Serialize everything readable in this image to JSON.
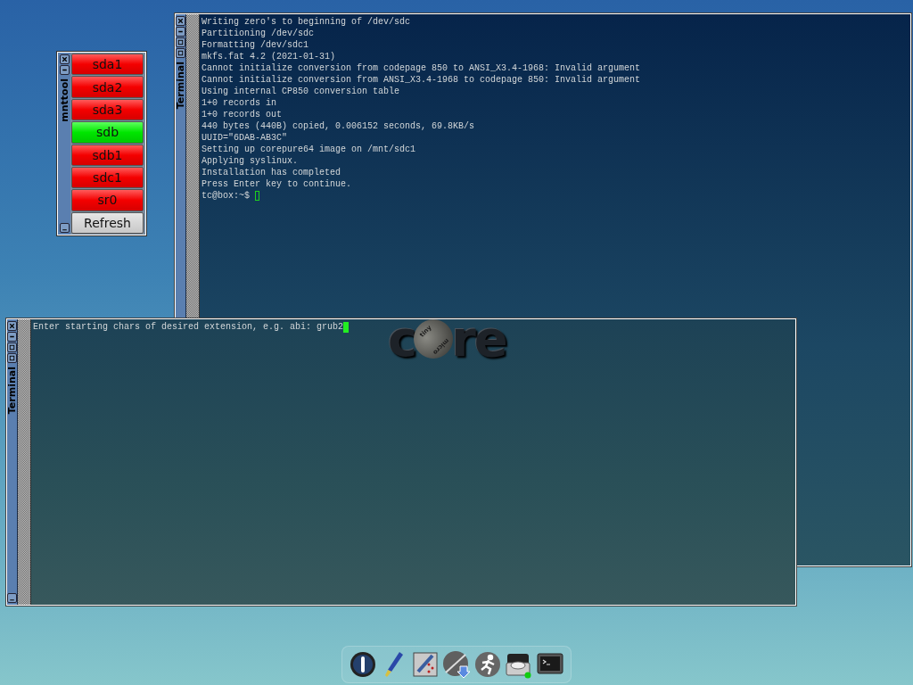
{
  "mnttool": {
    "title": "mnttool",
    "devices": [
      {
        "label": "sda1",
        "kind": "device",
        "mounted": false
      },
      {
        "label": "sda2",
        "kind": "device",
        "mounted": false
      },
      {
        "label": "sda3",
        "kind": "device",
        "mounted": false
      },
      {
        "label": "sdb",
        "kind": "device",
        "mounted": true
      },
      {
        "label": "sdb1",
        "kind": "device",
        "mounted": false
      },
      {
        "label": "sdc1",
        "kind": "device",
        "mounted": false
      },
      {
        "label": "sr0",
        "kind": "device",
        "mounted": false
      },
      {
        "label": "Refresh",
        "kind": "action"
      }
    ]
  },
  "terminals": [
    {
      "title": "Terminal",
      "cursor_filled": false,
      "lines": [
        "Writing zero's to beginning of /dev/sdc",
        "Partitioning /dev/sdc",
        "Formatting /dev/sdc1",
        "mkfs.fat 4.2 (2021-01-31)",
        "Cannot initialize conversion from codepage 850 to ANSI_X3.4-1968: Invalid argument",
        "Cannot initialize conversion from ANSI_X3.4-1968 to codepage 850: Invalid argument",
        "Using internal CP850 conversion table",
        "1+0 records in",
        "1+0 records out",
        "440 bytes (440B) copied, 0.006152 seconds, 69.8KB/s",
        "UUID=\"6DAB-AB3C\"",
        "Setting up corepure64 image on /mnt/sdc1",
        "Applying syslinux.",
        "Installation has completed",
        "Press Enter key to continue.",
        "tc@box:~$ "
      ]
    },
    {
      "title": "Terminal",
      "cursor_filled": true,
      "lines": [
        "Enter starting chars of desired extension, e.g. abi: grub2"
      ]
    }
  ],
  "logo": {
    "left": "c",
    "right": "re",
    "ball_top": "tiny",
    "ball_bottom": "micro"
  }
}
